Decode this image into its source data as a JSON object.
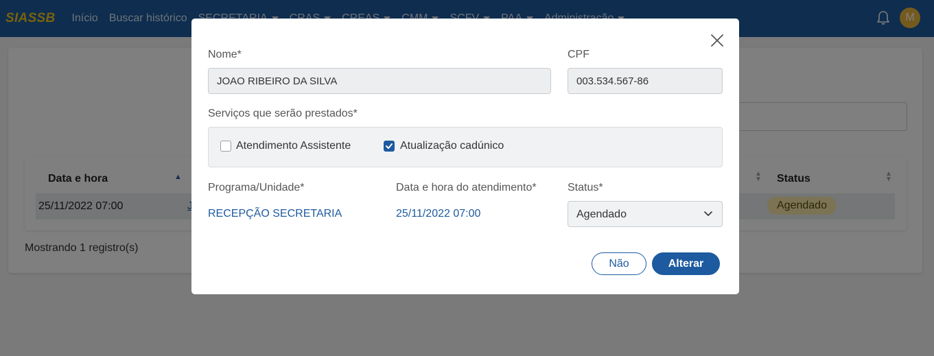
{
  "app": {
    "brand": "SIASSB",
    "nav": [
      {
        "label": "Início",
        "dropdown": false
      },
      {
        "label": "Buscar histórico",
        "dropdown": false
      },
      {
        "label": "SECRETARIA",
        "dropdown": true
      },
      {
        "label": "CRAS",
        "dropdown": true
      },
      {
        "label": "CREAS",
        "dropdown": true
      },
      {
        "label": "CMM",
        "dropdown": true
      },
      {
        "label": "SCFV",
        "dropdown": true
      },
      {
        "label": "PAA",
        "dropdown": true
      },
      {
        "label": "Administração",
        "dropdown": true
      }
    ],
    "avatar_initial": "M"
  },
  "table": {
    "headers": {
      "date": "Data e hora",
      "status": "Status"
    },
    "row": {
      "date": "25/11/2022 07:00",
      "col2_fragment": "J",
      "status": "Agendado"
    },
    "footer": "Mostrando 1 registro(s)"
  },
  "modal": {
    "nome_label": "Nome*",
    "nome_value": "JOAO RIBEIRO DA SILVA",
    "cpf_label": "CPF",
    "cpf_value": "003.534.567-86",
    "services_label": "Serviços que serão prestados*",
    "services": [
      {
        "label": "Atendimento Assistente",
        "checked": false
      },
      {
        "label": "Atualização cadúnico",
        "checked": true
      }
    ],
    "programa_label": "Programa/Unidade*",
    "programa_value": "RECEPÇÃO SECRETARIA",
    "datahora_label": "Data e hora do atendimento*",
    "datahora_value": "25/11/2022 07:00",
    "status_label": "Status*",
    "status_value": "Agendado",
    "btn_no": "Não",
    "btn_yes": "Alterar"
  },
  "colors": {
    "primary": "#1d5a9f",
    "brand_yellow": "#f0c419",
    "badge_bg": "#f7e7a9"
  }
}
